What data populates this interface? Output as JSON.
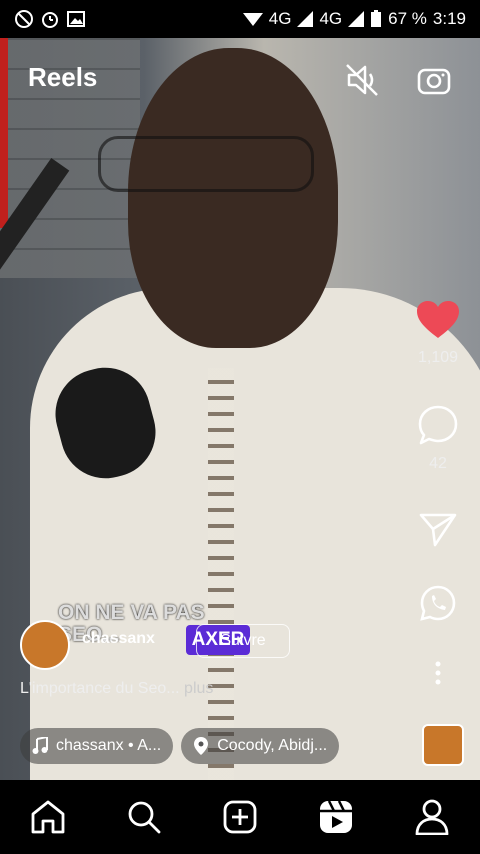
{
  "status_bar": {
    "network_left": "4G",
    "network_right": "4G",
    "battery": "67 %",
    "time": "3:19"
  },
  "header": {
    "title": "Reels",
    "mute_icon": "speaker-muted-icon",
    "camera_icon": "camera-icon"
  },
  "actions": {
    "likes": "1,109",
    "comments": "42",
    "like_color": "#ed4956"
  },
  "post": {
    "overlay_text_line1": "ON NE VA PAS",
    "overlay_text_line2": "SEO...",
    "username": "chassanx",
    "badge_text": "AXER",
    "follow_label": "Suivre",
    "caption": "L'importance du Seo...",
    "more": "plus",
    "audio": "chassanx • A...",
    "location": "Cocody, Abidj..."
  },
  "nav": {
    "items": [
      "home-icon",
      "search-icon",
      "create-icon",
      "reels-icon",
      "profile-icon"
    ]
  }
}
